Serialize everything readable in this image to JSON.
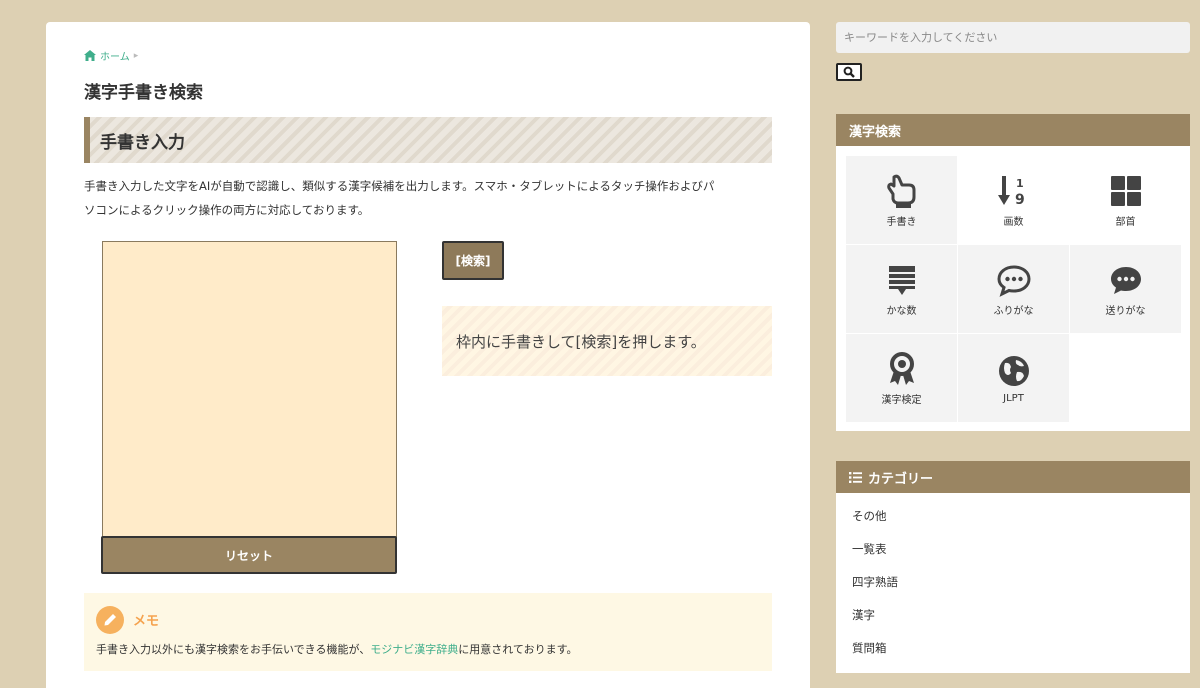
{
  "breadcrumb": {
    "home_label": "ホーム"
  },
  "page_title": "漢字手書き検索",
  "section_heading": "手書き入力",
  "description": [
    "手書き入力した文字をAIが自動で認識し、類似する漢字候補を出力します。スマホ・タブレットによるタッチ操作およびパ",
    "ソコンによるクリック操作の両方に対応しております。"
  ],
  "buttons": {
    "search_label": "[検索]",
    "reset_label": "リセット"
  },
  "hint_text": "枠内に手書きして[検索]を押します。",
  "memo": {
    "title": "メモ",
    "text_before": "手書き入力以外にも漢字検索をお手伝いできる機能が、",
    "link_text": "モジナビ漢字辞典",
    "text_after": "に用意されております。"
  },
  "sidebar": {
    "search_placeholder": "キーワードを入力してください",
    "kanji_search": {
      "title": "漢字検索",
      "items": [
        {
          "label": "手書き",
          "icon": "pointing-hand-icon"
        },
        {
          "label": "画数",
          "icon": "sort-numeric-icon"
        },
        {
          "label": "部首",
          "icon": "grid-icon"
        },
        {
          "label": "かな数",
          "icon": "list-comment-icon"
        },
        {
          "label": "ふりがな",
          "icon": "comment-dots-outline-icon"
        },
        {
          "label": "送りがな",
          "icon": "comment-dots-icon"
        },
        {
          "label": "漢字検定",
          "icon": "award-icon"
        },
        {
          "label": "JLPT",
          "icon": "globe-icon"
        }
      ]
    },
    "categories": {
      "title": "カテゴリー",
      "items": [
        "その他",
        "一覧表",
        "四字熟語",
        "漢字",
        "質問箱"
      ]
    }
  },
  "colors": {
    "page_background": "#ddd0b3",
    "accent_brown": "#9a8562",
    "canvas_fill": "#ffebc9",
    "link_green": "#3fae8b",
    "memo_orange": "#f5a34f"
  }
}
